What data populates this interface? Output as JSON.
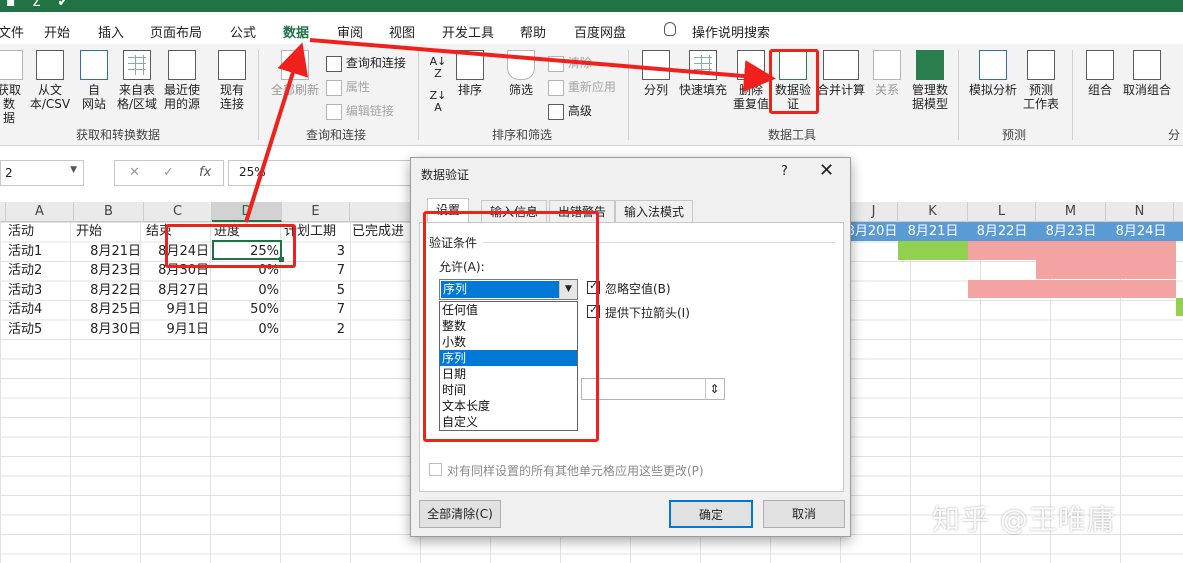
{
  "ribbon_tabs": {
    "file": "文件",
    "home": "开始",
    "insert": "插入",
    "page_layout": "页面布局",
    "formulas": "公式",
    "data": "数据",
    "review": "审阅",
    "view": "视图",
    "developer": "开发工具",
    "help": "帮助",
    "baidu": "百度网盘",
    "tell_me": "操作说明搜索"
  },
  "ribbon": {
    "get_transform": {
      "get_data": [
        "获取数",
        "据"
      ],
      "from_csv": [
        "从文",
        "本/CSV"
      ],
      "from_web": [
        "自",
        "网站"
      ],
      "from_table": [
        "来自表",
        "格/区域"
      ],
      "recent": [
        "最近使",
        "用的源"
      ],
      "existing": [
        "现有",
        "连接"
      ],
      "label": "获取和转换数据"
    },
    "queries": {
      "refresh_all": [
        "全部刷新"
      ],
      "queries_connections": "查询和连接",
      "properties": "属性",
      "edit_links": "编辑链接",
      "label": "查询和连接"
    },
    "sort_filter": {
      "sort": "排序",
      "filter": "筛选",
      "clear": "清除",
      "reapply": "重新应用",
      "advanced": "高级",
      "label": "排序和筛选"
    },
    "data_tools": {
      "text_to_columns": "分列",
      "flash_fill": "快速填充",
      "remove_duplicates": [
        "删除",
        "重复值"
      ],
      "data_validation": [
        "数据验",
        "证"
      ],
      "consolidate": "合并计算",
      "relationships": "关系",
      "data_model": [
        "管理数",
        "据模型"
      ],
      "label": "数据工具"
    },
    "forecast": {
      "what_if": [
        "模拟分析"
      ],
      "forecast_sheet": [
        "预测",
        "工作表"
      ],
      "label": "预测"
    },
    "outline": {
      "group": "组合",
      "ungroup": "取消组合",
      "label": "分"
    }
  },
  "formula_bar": {
    "name_box": "2",
    "cancel": "✕",
    "enter": "✓",
    "fx": "fx",
    "value": "25%"
  },
  "columns": [
    "A",
    "B",
    "C",
    "D",
    "E",
    "J",
    "K",
    "L",
    "M",
    "N"
  ],
  "gantt_header": [
    "8月20日",
    "8月21日",
    "8月22日",
    "8月23日",
    "8月24日"
  ],
  "table": {
    "headers": [
      "活动",
      "开始",
      "结束",
      "进度",
      "计划工期",
      "已完成进"
    ],
    "rows": [
      [
        "活动1",
        "8月21日",
        "8月24日",
        "25%",
        "3"
      ],
      [
        "活动2",
        "8月23日",
        "8月30日",
        "0%",
        "7"
      ],
      [
        "活动3",
        "8月22日",
        "8月27日",
        "0%",
        "5"
      ],
      [
        "活动4",
        "8月25日",
        "9月1日",
        "50%",
        "7"
      ],
      [
        "活动5",
        "8月30日",
        "9月1日",
        "0%",
        "2"
      ]
    ]
  },
  "dialog": {
    "title": "数据验证",
    "help": "?",
    "close": "✕",
    "tabs": [
      "设置",
      "输入信息",
      "出错警告",
      "输入法模式"
    ],
    "section": "验证条件",
    "allow_label": "允许(A):",
    "allow_value": "序列",
    "allow_options": [
      "任何值",
      "整数",
      "小数",
      "序列",
      "日期",
      "时间",
      "文本长度",
      "自定义"
    ],
    "ignore_blank": "忽略空值(B)",
    "in_cell_dropdown": "提供下拉箭头(I)",
    "source_button": "⇕",
    "apply_all": "对有同样设置的所有其他单元格应用这些更改(P)",
    "clear_all": "全部清除(C)",
    "ok": "确定",
    "cancel": "取消"
  },
  "watermark": "知乎 @王唯庸",
  "colors": {
    "accent": "#217346",
    "annotation": "#f0201c",
    "gantt_blue": "#5b9bd5",
    "gantt_green": "#92d050",
    "gantt_red": "#f4a3a3"
  }
}
